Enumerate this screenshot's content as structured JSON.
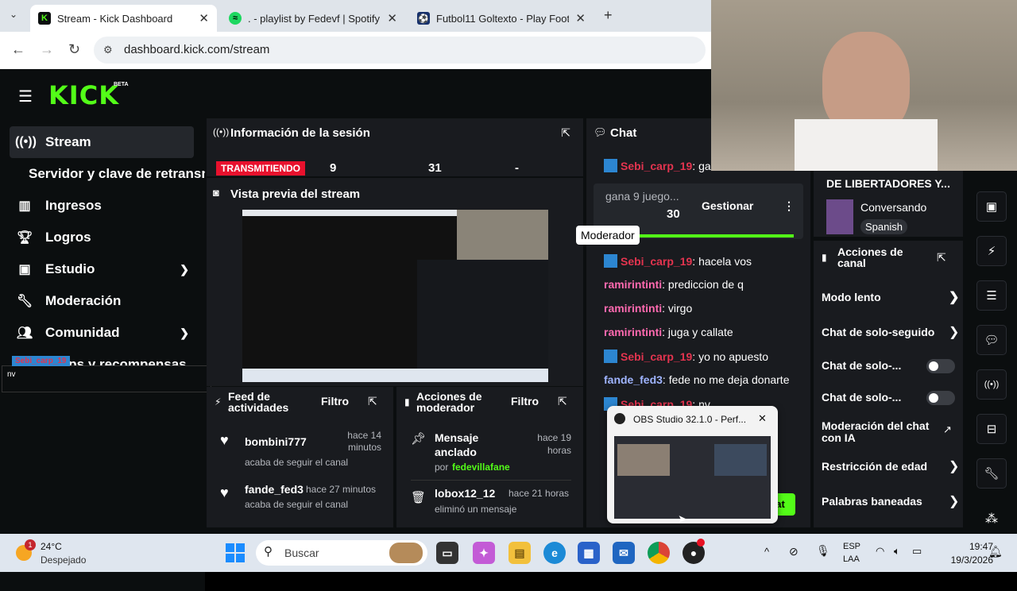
{
  "browser": {
    "tabs": [
      {
        "title": "Stream - Kick Dashboard",
        "active": true
      },
      {
        "title": ". - playlist by Fedevf | Spotify",
        "active": false
      },
      {
        "title": "Futbol11 Goltexto - Play Footb",
        "active": false
      }
    ],
    "url": "dashboard.kick.com/stream"
  },
  "brand": {
    "logo": "KICK",
    "beta": "BETA",
    "accent": "#53fc18"
  },
  "sidebar": {
    "items": [
      {
        "label": "Stream",
        "icon": "broadcast-icon"
      },
      {
        "label": "Servidor y clave de retransm",
        "icon": ""
      },
      {
        "label": "Ingresos",
        "icon": "chart-icon"
      },
      {
        "label": "Logros",
        "icon": "trophy-icon"
      },
      {
        "label": "Estudio",
        "icon": "studio-icon"
      },
      {
        "label": "Moderación",
        "icon": "wrench-icon"
      },
      {
        "label": "Comunidad",
        "icon": "people-icon"
      },
      {
        "label": "Drops y recompensas",
        "icon": "drops-icon"
      }
    ],
    "overlay_name": "Sebi_carp_19",
    "overlay_text": "nv"
  },
  "session": {
    "title": "Información de la sesión",
    "status": "TRANSMITIENDO",
    "viewers": "9",
    "followers": "31",
    "extra": "-"
  },
  "preview": {
    "title": "Vista previa del stream"
  },
  "activity": {
    "title_1": "Feed de",
    "title_2": "actividades",
    "filter": "Filtro",
    "items": [
      {
        "user": "bombini777",
        "time": "hace 14 minutos",
        "text": "acaba de seguir el canal"
      },
      {
        "user": "fande_fed3",
        "time": "hace 27 minutos",
        "text": "acaba de seguir el canal"
      }
    ]
  },
  "modactions": {
    "title_1": "Acciones de",
    "title_2": "moderador",
    "filter": "Filtro",
    "items": [
      {
        "title": "Mensaje anclado",
        "by": "por",
        "user": "fedevillafane",
        "time": "hace 19 horas"
      },
      {
        "title": "lobox12_12",
        "text": "eliminó un mensaje",
        "time": "hace 21 horas"
      }
    ]
  },
  "chat": {
    "title": "Chat",
    "pinned_text": "gana 9 juego...",
    "pinned_count": "30",
    "manage": "Gestionar",
    "tooltip": "Moderador",
    "messages": [
      {
        "user": "Sebi_carp_19",
        "text": ": garr"
      },
      {
        "user": "Sebi_carp_19",
        "text": ": hacela vos"
      },
      {
        "user": "ramirintinti",
        "text": ": prediccion de q"
      },
      {
        "user": "ramirintinti",
        "text": ": virgo"
      },
      {
        "user": "ramirintinti",
        "text": ": juga y callate"
      },
      {
        "user": "Sebi_carp_19",
        "text": ": yo no apuesto"
      },
      {
        "user": "fande_fed3",
        "text": ": fede no me deja donarte"
      },
      {
        "user": "Sebi_carp_19",
        "text": ": nv"
      }
    ],
    "send": "at"
  },
  "stream_info": {
    "title": "DE LIBERTADORES Y...",
    "category": "Conversando",
    "language": "Spanish"
  },
  "channel_actions": {
    "title_1": "Acciones de",
    "title_2": "canal",
    "rows": [
      {
        "label": "Modo lento",
        "control": "chevron"
      },
      {
        "label": "Chat de solo-seguido",
        "control": "chevron"
      },
      {
        "label": "Chat de solo-...",
        "control": "toggle"
      },
      {
        "label": "Chat de solo-...",
        "control": "toggle"
      },
      {
        "label": "Moderación del chat con IA",
        "control": "external"
      },
      {
        "label": "Restricción de edad",
        "control": "chevron"
      },
      {
        "label": "Palabras baneadas",
        "control": "chevron"
      }
    ]
  },
  "obs_popup": {
    "title": "OBS Studio 32.1.0 - Perf..."
  },
  "taskbar": {
    "weather_temp": "24°C",
    "weather_desc": "Despejado",
    "weather_badge": "1",
    "search": "Buscar",
    "lang_1": "ESP",
    "lang_2": "LAA",
    "time": "19:47",
    "date": "19/3/2026"
  }
}
